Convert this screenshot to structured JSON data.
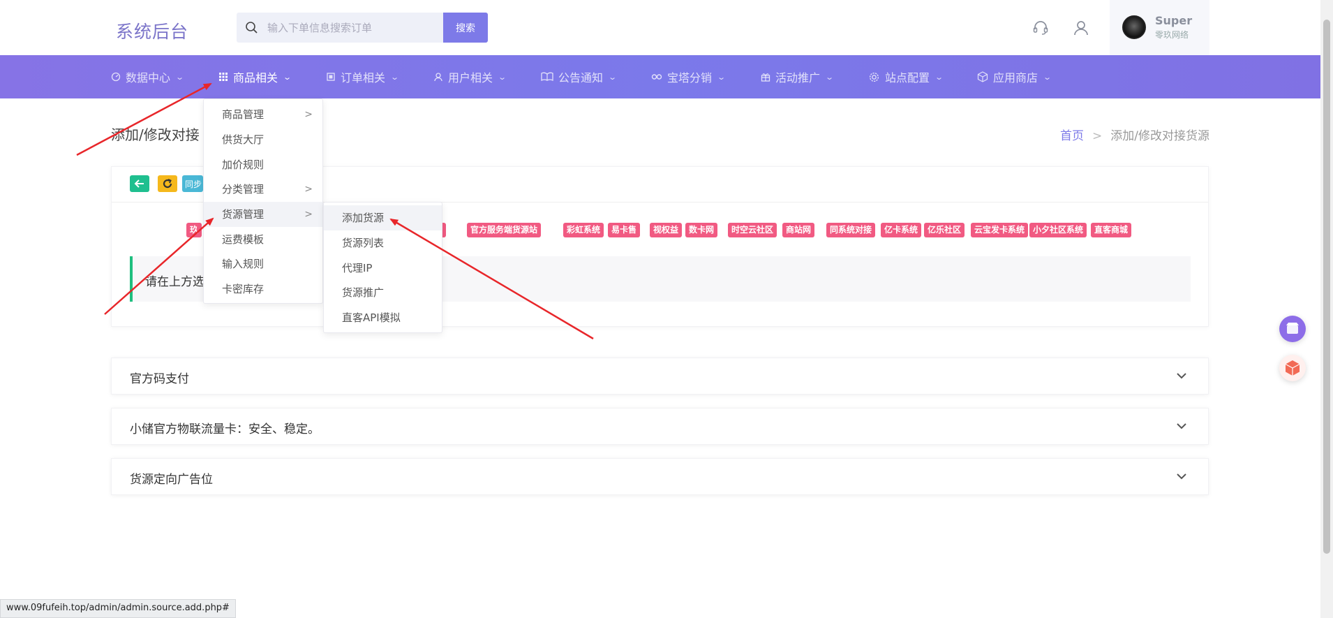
{
  "header": {
    "logo": "系统后台",
    "search_placeholder": "输入下单信息搜索订单",
    "search_button": "搜索",
    "user_name": "Super",
    "user_sub": "零玖网络"
  },
  "nav": {
    "items": [
      {
        "label": "数据中心",
        "icon": "dashboard-icon"
      },
      {
        "label": "商品相关",
        "icon": "grid-icon"
      },
      {
        "label": "订单相关",
        "icon": "order-icon"
      },
      {
        "label": "用户相关",
        "icon": "user-icon"
      },
      {
        "label": "公告通知",
        "icon": "book-icon"
      },
      {
        "label": "宝塔分销",
        "icon": "link-icon"
      },
      {
        "label": "活动推广",
        "icon": "gift-icon"
      },
      {
        "label": "站点配置",
        "icon": "gear-icon"
      },
      {
        "label": "应用商店",
        "icon": "box-icon"
      }
    ]
  },
  "page": {
    "title": "添加/修改对接",
    "breadcrumb_home": "首页",
    "breadcrumb_sep": ">",
    "breadcrumb_current": "添加/修改对接货源"
  },
  "toolbar": {
    "sync_label": "同步"
  },
  "tags": [
    "玖",
    "S)",
    "官方服务端货源站",
    "彩虹系统",
    "易卡售",
    "视权益",
    "数卡网",
    "时空云社区",
    "商站网",
    "同系统对接",
    "亿卡系统",
    "亿乐社区",
    "云宝发卡系统",
    "小夕社区系统",
    "直客商城"
  ],
  "notice": "请在上方选",
  "accordions": [
    {
      "title": "官方码支付"
    },
    {
      "title": "小储官方物联流量卡：安全、稳定。"
    },
    {
      "title": "货源定向广告位"
    }
  ],
  "menu_goods": [
    {
      "label": "商品管理",
      "arrow": ">"
    },
    {
      "label": "供货大厅"
    },
    {
      "label": "加价规则"
    },
    {
      "label": "分类管理",
      "arrow": ">"
    },
    {
      "label": "货源管理",
      "arrow": ">"
    },
    {
      "label": "运费模板"
    },
    {
      "label": "输入规则"
    },
    {
      "label": "卡密库存"
    }
  ],
  "menu_source": [
    {
      "label": "添加货源"
    },
    {
      "label": "货源列表"
    },
    {
      "label": "代理IP"
    },
    {
      "label": "货源推广"
    },
    {
      "label": "直客API模拟"
    }
  ],
  "status_url": "www.09fufeih.top/admin/admin.source.add.php#",
  "colors": {
    "accent": "#7d7ae8",
    "tag": "#f15a82",
    "notice_border": "#1fbf7f",
    "arrow": "#e8262a"
  }
}
